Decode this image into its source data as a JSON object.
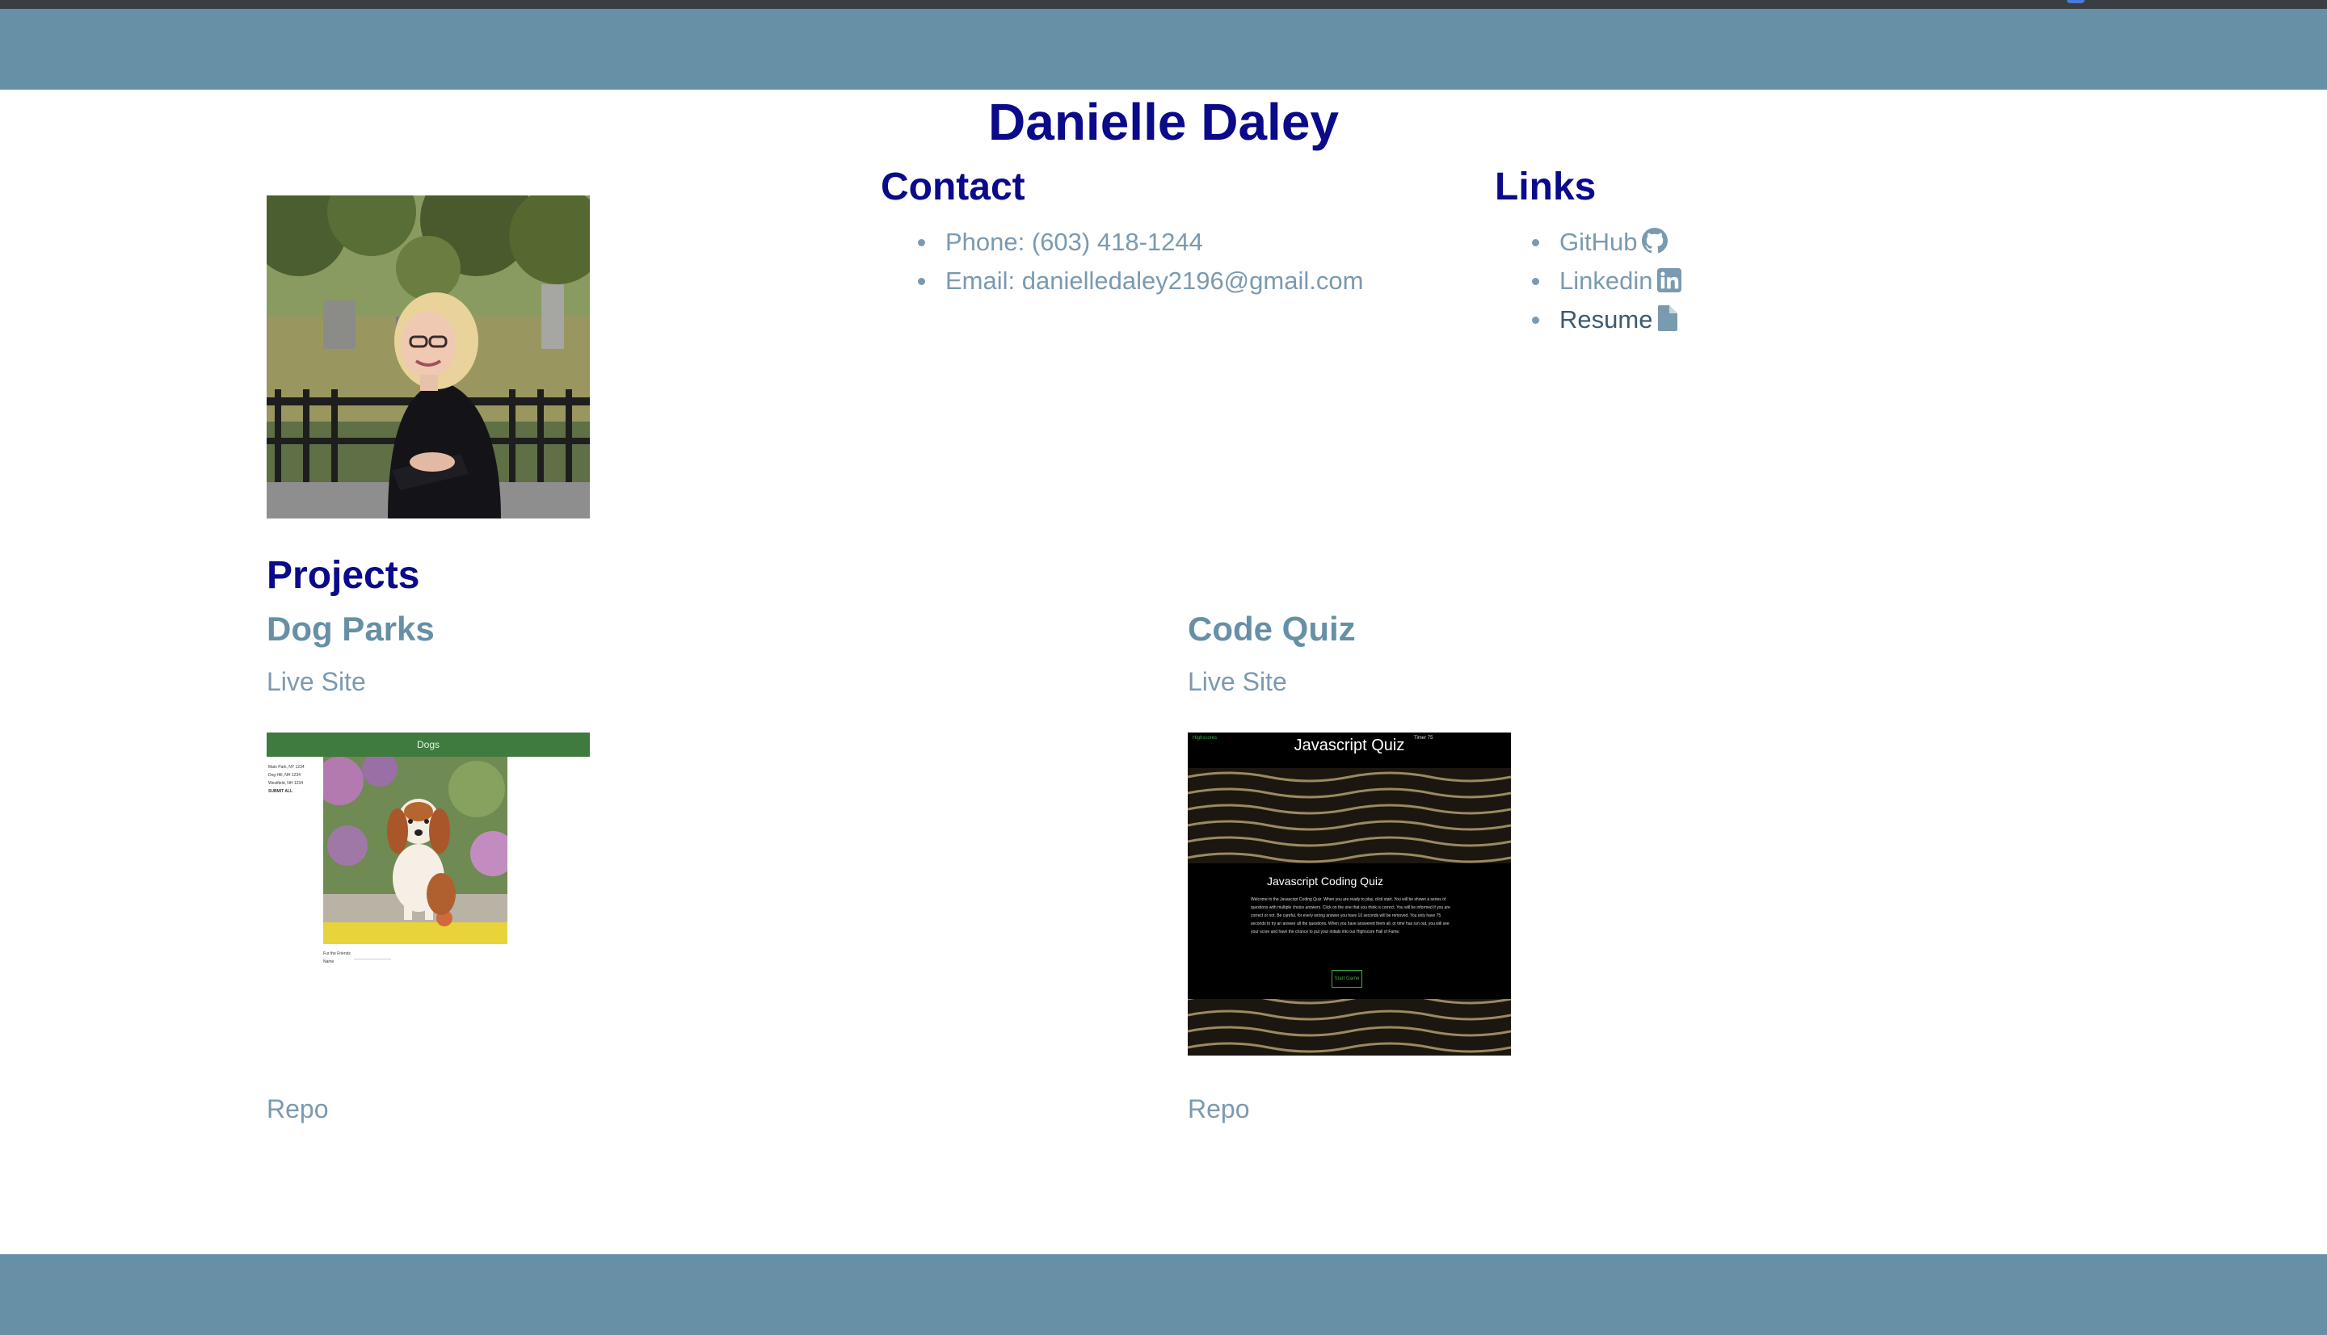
{
  "profile": {
    "name": "Danielle Daley"
  },
  "contact": {
    "heading": "Contact",
    "phone": "Phone: (603) 418-1244",
    "email": "Email: danielledaley2196@gmail.com"
  },
  "links": {
    "heading": "Links",
    "items": [
      {
        "label": "GitHub",
        "icon": "github-icon"
      },
      {
        "label": "Linkedin",
        "icon": "linkedin-icon"
      },
      {
        "label": "Resume",
        "icon": "file-icon"
      }
    ]
  },
  "projects": {
    "heading": "Projects",
    "items": [
      {
        "title": "Dog Parks",
        "live_label": "Live Site",
        "repo_label": "Repo",
        "screenshot": {
          "header": "Dogs",
          "sidebar_lines": [
            "Main Park, NY 1234",
            "Dog Hill, NH 1234",
            "Westfield, NH 1234",
            "SUBMIT ALL"
          ],
          "form_labels": [
            "Fur the Friends",
            "Name"
          ]
        }
      },
      {
        "title": "Code Quiz",
        "live_label": "Live Site",
        "repo_label": "Repo",
        "screenshot": {
          "highscores": "Highscores",
          "title": "Javascript Quiz",
          "timer": "Timer 75",
          "box_title": "Javascript Coding Quiz",
          "box_text": "Welcome to the Javascript Coding Quiz. When you are ready to play, click start. You will be shown a series of questions with multiple choice answers. Click on the one that you think is correct. You will be informed if you are correct or not. Be careful, for every wrong answer you have 10 seconds will be removed. You only have 75 seconds to try an answer all the questions. When you have answered them all, or time has run out, you will see your score and have the chance to put your initials into our Highscore Hall of Fame.",
          "button": "Start Game"
        }
      }
    ]
  },
  "colors": {
    "header_bg": "#6690a6",
    "heading": "#0a0a8a",
    "link": "#7a9ab0"
  }
}
